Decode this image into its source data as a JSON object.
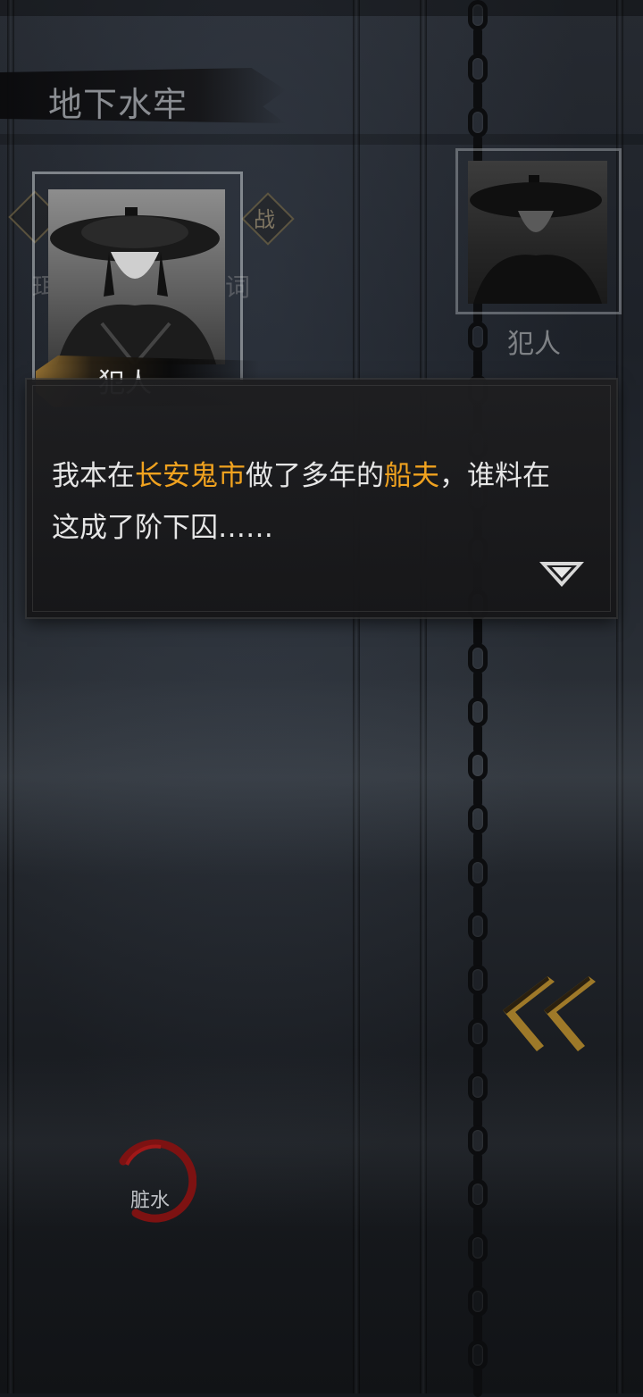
{
  "location": {
    "title": "地下水牢"
  },
  "speaker": {
    "name": "犯人"
  },
  "opponent": {
    "name": "犯人"
  },
  "hidden_menu": {
    "battle": "战",
    "left_partial": "珥",
    "right_partial": "词"
  },
  "dialogue": {
    "line1": {
      "p1": "我本在",
      "h1": "长安鬼市",
      "p2": "做了多年的",
      "h2": "船夫",
      "p3": "，谁料在"
    },
    "line2": "这成了阶下囚……"
  },
  "skill": {
    "label": "脏水"
  },
  "icons": {
    "next": "triangle-down-icon",
    "back": "double-chevron-left-icon"
  },
  "colors": {
    "highlight": "#f0a21f",
    "text": "#e6e6e6",
    "accent_red": "#8b1414"
  }
}
